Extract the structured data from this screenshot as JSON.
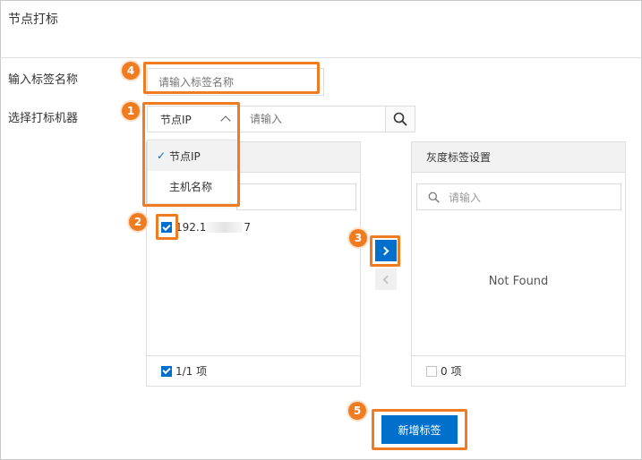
{
  "page": {
    "title": "节点打标"
  },
  "form": {
    "tag_name_label": "输入标签名称",
    "tag_name_placeholder": "请输入标签名称",
    "machine_label": "选择打标机器"
  },
  "selector": {
    "selected": "节点IP",
    "search_placeholder": "请输入",
    "options": [
      {
        "label": "节点IP",
        "selected": true
      },
      {
        "label": "主机名称",
        "selected": false
      }
    ]
  },
  "left_panel": {
    "items": [
      {
        "prefix": "192.1",
        "suffix": "7",
        "checked": true
      }
    ],
    "footer_count": "1/1 项"
  },
  "right_panel": {
    "title": "灰度标签设置",
    "search_placeholder": "请输入",
    "empty_text": "Not Found",
    "footer_count": "0 项"
  },
  "submit_label": "新增标签",
  "annotations": {
    "badges": [
      "1",
      "2",
      "3",
      "4",
      "5"
    ]
  },
  "colors": {
    "primary": "#0070cc",
    "annotation": "#f07c22"
  }
}
